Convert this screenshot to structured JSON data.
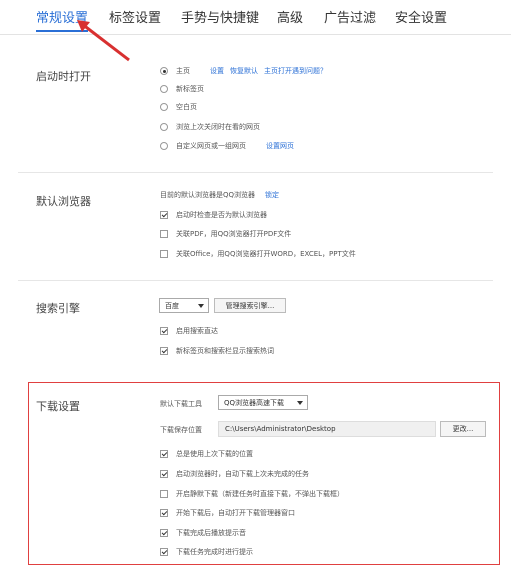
{
  "tabs": [
    {
      "label": "常规设置",
      "active": true
    },
    {
      "label": "标签设置",
      "active": false
    },
    {
      "label": "手势与快捷键",
      "active": false
    },
    {
      "label": "高级",
      "active": false
    },
    {
      "label": "广告过滤",
      "active": false
    },
    {
      "label": "安全设置",
      "active": false
    }
  ],
  "startup": {
    "title": "启动时打开",
    "options": [
      {
        "label": "主页",
        "checked": true,
        "links": [
          "设置",
          "恢复默认",
          "主页打开遇到问题？"
        ]
      },
      {
        "label": "新标签页",
        "checked": false,
        "links": []
      },
      {
        "label": "空白页",
        "checked": false,
        "links": []
      },
      {
        "label": "浏览上次关闭时在看的网页",
        "checked": false,
        "links": []
      },
      {
        "label": "自定义网页或一组网页",
        "checked": false,
        "links": [
          "设置网页"
        ]
      }
    ]
  },
  "default_browser": {
    "title": "默认浏览器",
    "status": "目前的默认浏览器是QQ浏览器",
    "status_link": "锁定",
    "options": [
      {
        "label": "启动时检查是否为默认浏览器",
        "checked": true
      },
      {
        "label": "关联PDF，用QQ浏览器打开PDF文件",
        "checked": false
      },
      {
        "label": "关联Office，用QQ浏览器打开WORD，EXCEL，PPT文件",
        "checked": false
      }
    ]
  },
  "search": {
    "title": "搜索引擎",
    "engine": "百度",
    "manage_button": "管理搜索引擎...",
    "options": [
      {
        "label": "启用搜索直达",
        "checked": true
      },
      {
        "label": "新标签页和搜索栏显示搜索热词",
        "checked": true
      }
    ]
  },
  "download": {
    "title": "下载设置",
    "tool_label": "默认下载工具",
    "tool_value": "QQ浏览器高速下载",
    "path_label": "下载保存位置",
    "path_value": "C:\\Users\\Administrator\\Desktop",
    "change_button": "更改...",
    "options": [
      {
        "label": "总是使用上次下载的位置",
        "checked": true
      },
      {
        "label": "启动浏览器时，自动下载上次未完成的任务",
        "checked": true
      },
      {
        "label": "开启静默下载（新建任务时直接下载，不弹出下载框）",
        "checked": false
      },
      {
        "label": "开始下载后，自动打开下载管理器窗口",
        "checked": true
      },
      {
        "label": "下载完成后播放提示音",
        "checked": true
      },
      {
        "label": "下载任务完成时进行提示",
        "checked": true
      }
    ]
  },
  "colors": {
    "accent": "#2a6fd6",
    "highlight": "#e04040"
  }
}
